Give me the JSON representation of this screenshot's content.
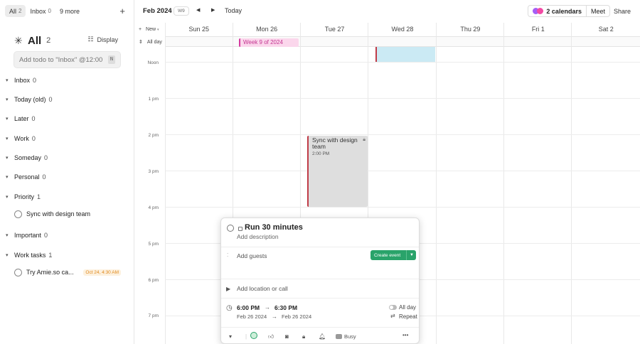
{
  "sidebar": {
    "tabs": [
      {
        "label": "All",
        "count": "2"
      },
      {
        "label": "Inbox",
        "count": "0"
      },
      {
        "label": "9 more"
      }
    ],
    "header": {
      "title": "All",
      "count": "2",
      "display_label": "Display"
    },
    "add_placeholder": "Add todo to \"Inbox\" @12:00",
    "add_shortcut": "N",
    "groups": [
      {
        "name": "Inbox",
        "count": "0"
      },
      {
        "name": "Today (old)",
        "count": "0"
      },
      {
        "name": "Later",
        "count": "0"
      },
      {
        "name": "Work",
        "count": "0"
      },
      {
        "name": "Someday",
        "count": "0"
      },
      {
        "name": "Personal",
        "count": "0"
      },
      {
        "name": "Priority",
        "count": "1"
      },
      {
        "name": "Important",
        "count": "0"
      },
      {
        "name": "Work tasks",
        "count": "1"
      }
    ],
    "tasks": [
      {
        "name": "Sync with design team",
        "badge": ""
      },
      {
        "name": "Try Amie.so ca...",
        "badge": "Oct 24, 4:30 AM"
      }
    ]
  },
  "calendar": {
    "month": "Feb 2024",
    "week": "W9",
    "today_label": "Today",
    "calendars_label": "2 calendars",
    "meet_label": "Meet",
    "share_label": "Share",
    "new_label": "New",
    "allday_label": "All day",
    "days": [
      "Sun 25",
      "Mon 26",
      "Tue 27",
      "Wed 28",
      "Thu 29",
      "Fri  1",
      "Sat  2"
    ],
    "times": [
      "Noon",
      "1 pm",
      "2 pm",
      "3 pm",
      "4 pm",
      "5 pm",
      "6 pm",
      "7 pm"
    ],
    "week_event": "Week 9 of 2024",
    "sync_event": {
      "title": "Sync with design team",
      "time": "2:00 PM"
    }
  },
  "popup": {
    "title": "Run 30 minutes",
    "description": "Add description",
    "guests": "Add guests",
    "create_label": "Create event",
    "location": "Add location or call",
    "start_time": "6:00 PM",
    "end_time": "6:30 PM",
    "start_date": "Feb 26 2024",
    "end_date": "Feb 26 2024",
    "allday": "All day",
    "repeat": "Repeat",
    "busy": "Busy"
  },
  "colors": {
    "accent_green": "#29a36a",
    "event_red": "#c03b47",
    "week_pink": "#d63aa0",
    "badge_orange": "#e08a1e"
  }
}
